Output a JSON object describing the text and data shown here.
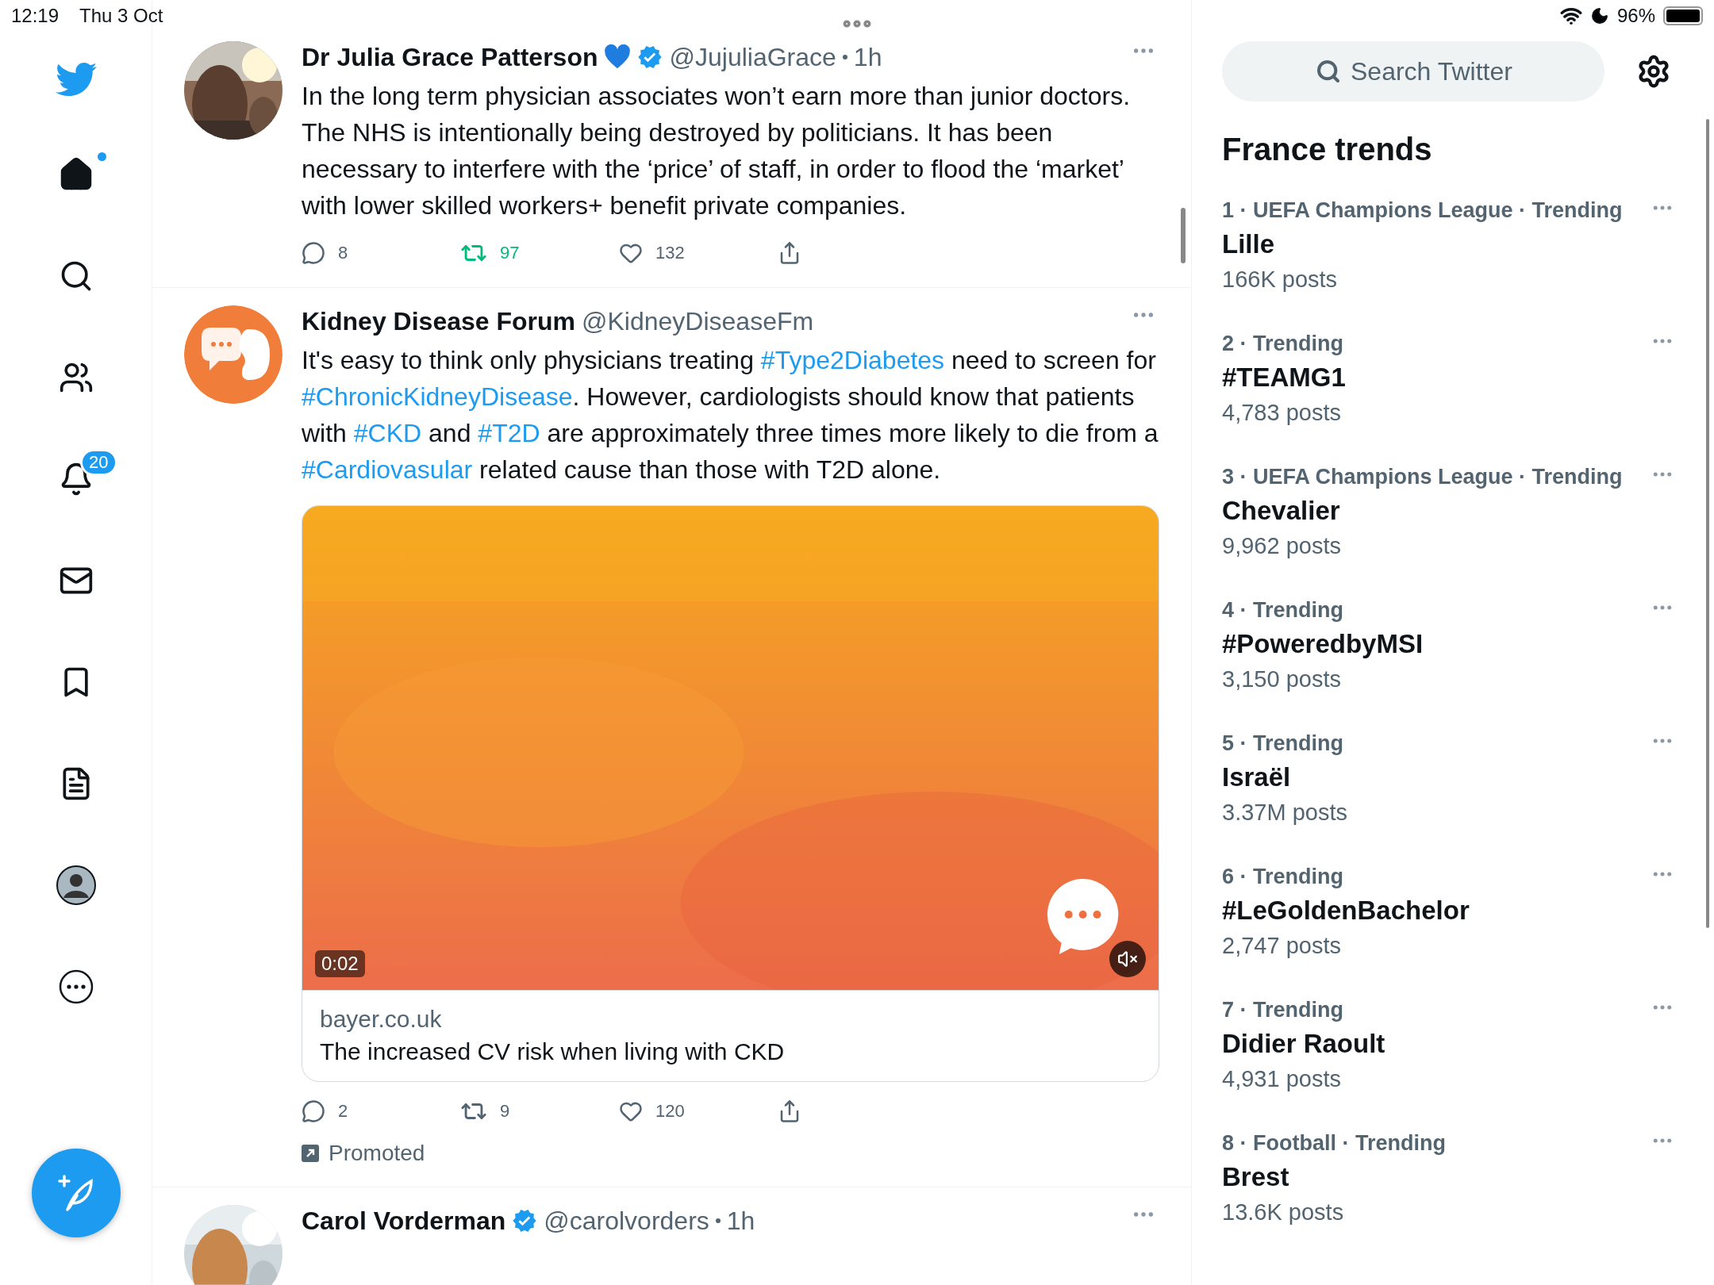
{
  "status_bar": {
    "time": "12:19",
    "date": "Thu 3 Oct",
    "battery": "96%"
  },
  "nav": {
    "items": [
      {
        "selected": true,
        "unread_dot": true
      },
      {
        "selected": false
      },
      {
        "selected": false
      },
      {
        "selected": false,
        "badge": "20"
      },
      {
        "selected": false
      },
      {
        "selected": false
      },
      {
        "selected": false
      },
      {
        "selected": false
      },
      {
        "selected": false
      }
    ]
  },
  "tweets": [
    {
      "name": "Dr Julia Grace Patterson",
      "heart": true,
      "verified": true,
      "handle": "@JujuliaGrace",
      "time": "1h",
      "body": [
        {
          "kind": "text",
          "text": "In the long term physician associates won’t earn more than junior doctors. The NHS is intentionally being destroyed by politicians. It has been necessary to interfere with the ‘price’ of staff, in order to flood the ‘market’ with lower skilled workers+ benefit private companies."
        }
      ],
      "stats": {
        "replies": "8",
        "retweets": "97",
        "retweeted": true,
        "likes": "132"
      }
    },
    {
      "avatar": {
        "kind": "logo"
      },
      "name": "Kidney Disease Forum",
      "heart": false,
      "verified": false,
      "handle": "@KidneyDiseaseFm",
      "body": [
        {
          "kind": "text",
          "text": "It's easy to think only physicians treating "
        },
        {
          "kind": "hashtag",
          "text": "#Type2Diabetes"
        },
        {
          "kind": "text",
          "text": " need to screen for "
        },
        {
          "kind": "hashtag",
          "text": "#ChronicKidneyDisease"
        },
        {
          "kind": "text",
          "text": ". However, cardiologists should know that patients with "
        },
        {
          "kind": "hashtag",
          "text": "#CKD"
        },
        {
          "kind": "text",
          "text": " and "
        },
        {
          "kind": "hashtag",
          "text": "#T2D"
        },
        {
          "kind": "text",
          "text": " are approximately three times more likely to die from a "
        },
        {
          "kind": "hashtag",
          "text": "#Cardiovasular"
        },
        {
          "kind": "text",
          "text": " related cause than those with T2D alone."
        }
      ],
      "media": {
        "kind": "video",
        "duration": "0:02",
        "muted": true,
        "domain": "bayer.co.uk",
        "title": "The increased CV risk when living with CKD"
      },
      "stats": {
        "replies": "2",
        "retweets": "9",
        "retweeted": false,
        "likes": "120"
      },
      "promoted": "Promoted"
    },
    {
      "name": "Carol Vorderman",
      "heart": false,
      "verified": true,
      "handle": "@carolvorders",
      "time": "1h"
    }
  ],
  "search": {
    "placeholder": "Search Twitter"
  },
  "trends": {
    "title": "France trends",
    "items": [
      {
        "meta": "1 · UEFA Champions League · Trending",
        "name": "Lille",
        "posts": "166K posts"
      },
      {
        "meta": "2 · Trending",
        "name": "#TEAMG1",
        "posts": "4,783 posts"
      },
      {
        "meta": "3 · UEFA Champions League · Trending",
        "name": "Chevalier",
        "posts": "9,962 posts"
      },
      {
        "meta": "4 · Trending",
        "name": "#PoweredbyMSI",
        "posts": "3,150 posts"
      },
      {
        "meta": "5 · Trending",
        "name": "Israël",
        "posts": "3.37M posts"
      },
      {
        "meta": "6 · Trending",
        "name": "#LeGoldenBachelor",
        "posts": "2,747 posts"
      },
      {
        "meta": "7 · Trending",
        "name": "Didier Raoult",
        "posts": "4,931 posts"
      },
      {
        "meta": "8 · Football · Trending",
        "name": "Brest",
        "posts": "13.6K posts"
      }
    ]
  }
}
